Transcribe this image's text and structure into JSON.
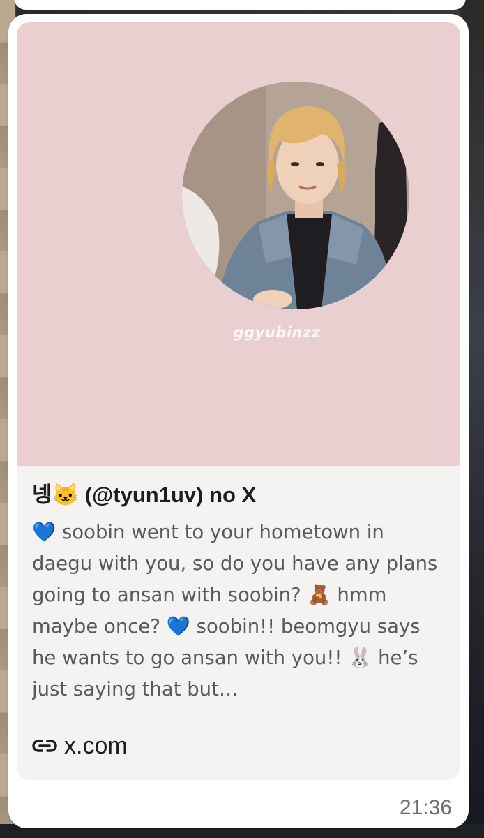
{
  "message": {
    "link_preview": {
      "image_watermark": "ggyubinzz",
      "title": "넹🐱 (@tyun1uv) no X",
      "description": "💙 soobin went to your hometown in daegu with you, so do you have any plans going to ansan with soobin? 🧸 hmm maybe once? 💙 soobin!! beomgyu says he wants to go ansan with you!! 🐰 he’s just saying that but…",
      "domain": "x.com",
      "link_icon": "link-icon"
    },
    "timestamp": "21:36"
  },
  "colors": {
    "bubble": "#ffffff",
    "preview_card": "#f5f3f2",
    "image_bg": "#eacfd0",
    "title_text": "#1d1d1d",
    "desc_text": "#5a5a5a",
    "timestamp": "#6e6e6e"
  }
}
